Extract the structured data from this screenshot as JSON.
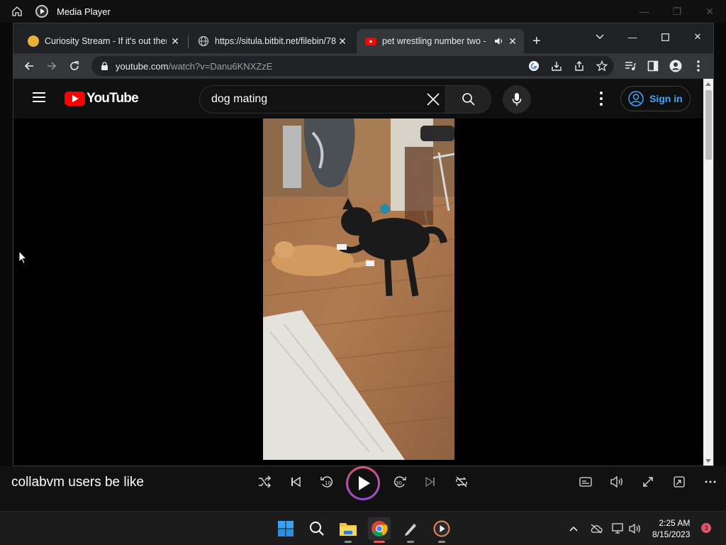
{
  "media_player": {
    "title": "Media Player",
    "track_title": "collabvm users be like",
    "controls": [
      "shuffle",
      "previous",
      "rewind-10",
      "play",
      "forward-30",
      "next",
      "repeat"
    ],
    "right_controls": [
      "subtitles",
      "volume",
      "fullscreen",
      "mini-player",
      "more"
    ]
  },
  "browser": {
    "tabs": [
      {
        "title": "Curiosity Stream - If it's out there",
        "favicon": "bulb-icon",
        "active": false
      },
      {
        "title": "https://situla.bitbit.net/filebin/78",
        "favicon": "globe-icon",
        "active": false
      },
      {
        "title": "pet wrestling number two -",
        "favicon": "youtube-icon",
        "active": true,
        "audio": true
      }
    ],
    "url_host": "youtube.com",
    "url_path": "/watch?v=Danu6KNXZzE"
  },
  "youtube": {
    "logo_text": "YouTube",
    "search_query": "dog mating",
    "sign_in_label": "Sign in"
  },
  "taskbar": {
    "time": "2:25 AM",
    "date": "8/15/2023",
    "notification_count": "3"
  },
  "colors": {
    "youtube_red": "#ff0000",
    "sign_in_blue": "#3ea6ff",
    "accent_pink": "#e0566b",
    "accent_purple": "#8d4de0"
  }
}
